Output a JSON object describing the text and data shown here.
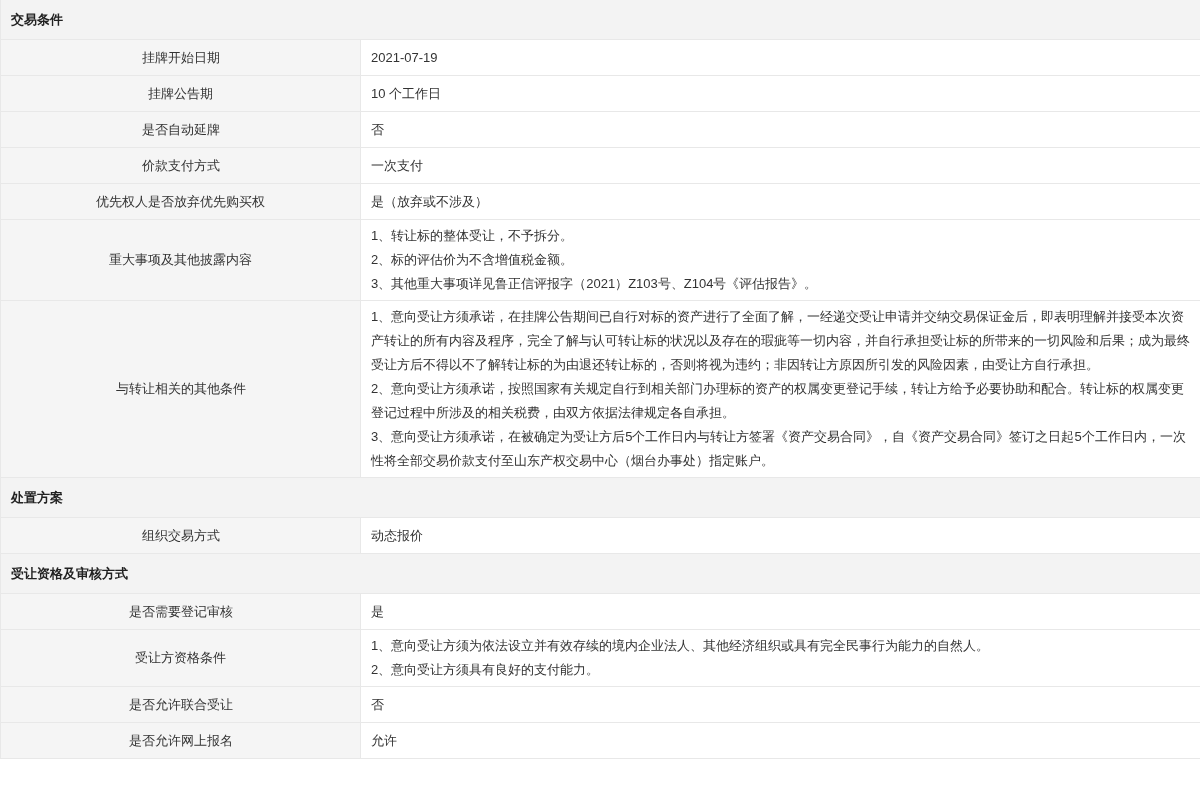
{
  "sections": [
    {
      "title": "交易条件",
      "rows": [
        {
          "label": "挂牌开始日期",
          "lines": [
            "2021-07-19"
          ]
        },
        {
          "label": "挂牌公告期",
          "lines": [
            "10 个工作日"
          ]
        },
        {
          "label": "是否自动延牌",
          "lines": [
            "否"
          ]
        },
        {
          "label": "价款支付方式",
          "lines": [
            "一次支付"
          ]
        },
        {
          "label": "优先权人是否放弃优先购买权",
          "lines": [
            "是（放弃或不涉及）"
          ]
        },
        {
          "label": "重大事项及其他披露内容",
          "lines": [
            "1、转让标的整体受让，不予拆分。",
            "2、标的评估价为不含增值税金额。",
            "3、其他重大事项详见鲁正信评报字（2021）Z103号、Z104号《评估报告》。"
          ]
        },
        {
          "label": "与转让相关的其他条件",
          "lines": [
            "1、意向受让方须承诺，在挂牌公告期间已自行对标的资产进行了全面了解，一经递交受让申请并交纳交易保证金后，即表明理解并接受本次资产转让的所有内容及程序，完全了解与认可转让标的状况以及存在的瑕疵等一切内容，并自行承担受让标的所带来的一切风险和后果；成为最终受让方后不得以不了解转让标的为由退还转让标的，否则将视为违约；非因转让方原因所引发的风险因素，由受让方自行承担。",
            "2、意向受让方须承诺，按照国家有关规定自行到相关部门办理标的资产的权属变更登记手续，转让方给予必要协助和配合。转让标的权属变更登记过程中所涉及的相关税费，由双方依据法律规定各自承担。",
            "3、意向受让方须承诺，在被确定为受让方后5个工作日内与转让方签署《资产交易合同》，自《资产交易合同》签订之日起5个工作日内，一次性将全部交易价款支付至山东产权交易中心（烟台办事处）指定账户。"
          ]
        }
      ]
    },
    {
      "title": "处置方案",
      "rows": [
        {
          "label": "组织交易方式",
          "lines": [
            "动态报价"
          ]
        }
      ]
    },
    {
      "title": "受让资格及审核方式",
      "rows": [
        {
          "label": "是否需要登记审核",
          "lines": [
            "是"
          ]
        },
        {
          "label": "受让方资格条件",
          "lines": [
            "1、意向受让方须为依法设立并有效存续的境内企业法人、其他经济组织或具有完全民事行为能力的自然人。",
            "2、意向受让方须具有良好的支付能力。"
          ]
        },
        {
          "label": "是否允许联合受让",
          "lines": [
            "否"
          ]
        },
        {
          "label": "是否允许网上报名",
          "lines": [
            "允许"
          ]
        }
      ]
    }
  ]
}
